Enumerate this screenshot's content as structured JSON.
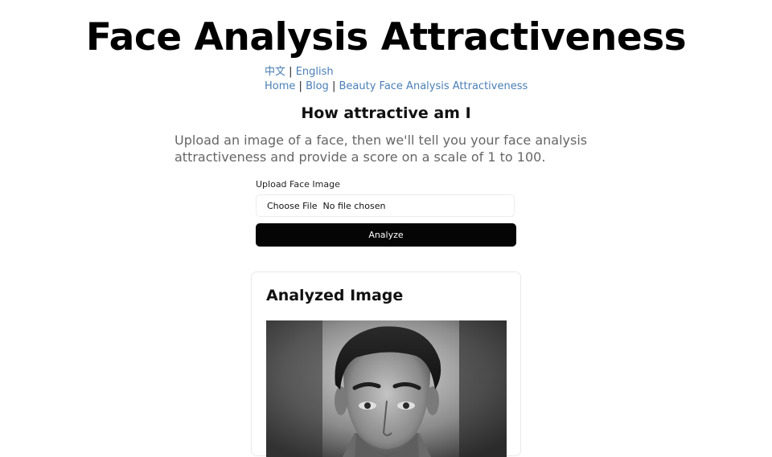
{
  "header": {
    "title": "Face Analysis Attractiveness"
  },
  "language": {
    "chinese": "中文",
    "separator": "|",
    "english": "English"
  },
  "nav": {
    "home": "Home",
    "blog": "Blog",
    "beauty": "Beauty Face Analysis Attractiveness",
    "separator": "|"
  },
  "main": {
    "heading": "How attractive am I",
    "description": "Upload an image of a face, then we'll tell you your face analysis attractiveness and provide a score on a scale of 1 to 100."
  },
  "form": {
    "upload_label": "Upload Face Image",
    "choose_file": "Choose File",
    "no_file": "No file chosen",
    "analyze_label": "Analyze"
  },
  "result": {
    "title": "Analyzed Image",
    "image_subject": "black-and-white portrait of a man"
  }
}
